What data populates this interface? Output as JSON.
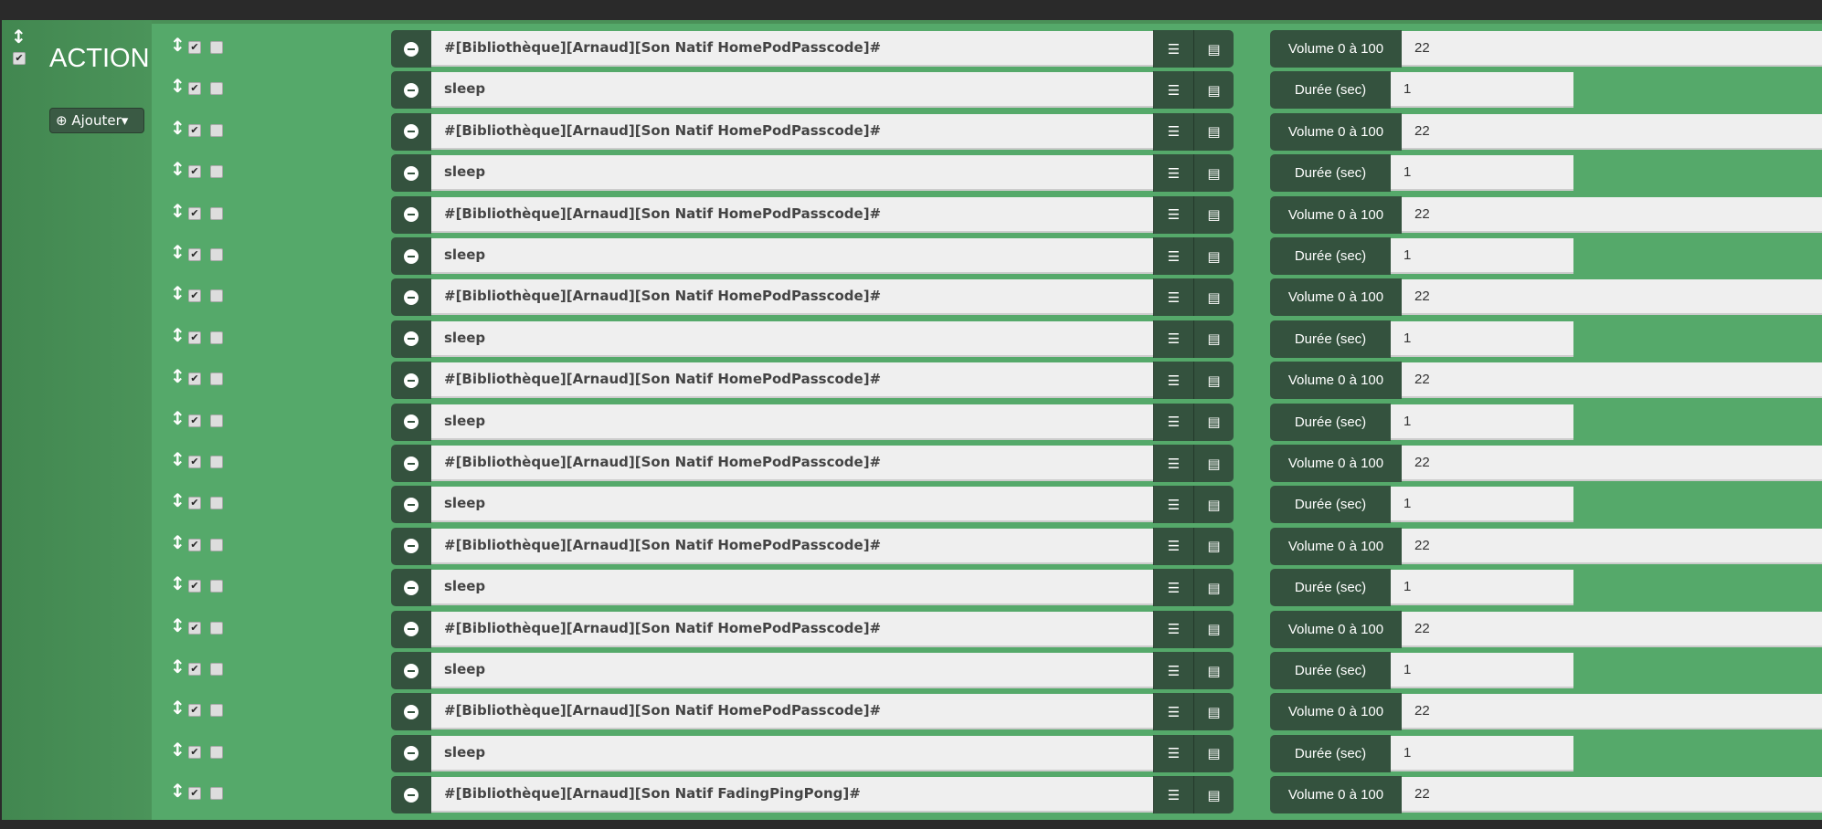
{
  "block": {
    "title": "ACTION",
    "add_label": "Ajouter",
    "enabled": true
  },
  "rows": [
    {
      "expression": "#[Bibliothèque][Arnaud][Son Natif HomePodPasscode]#",
      "param_label": "Volume 0 à 100",
      "param_value": "22"
    },
    {
      "expression": "sleep",
      "param_label": "Durée (sec)",
      "param_value": "1"
    },
    {
      "expression": "#[Bibliothèque][Arnaud][Son Natif HomePodPasscode]#",
      "param_label": "Volume 0 à 100",
      "param_value": "22"
    },
    {
      "expression": "sleep",
      "param_label": "Durée (sec)",
      "param_value": "1"
    },
    {
      "expression": "#[Bibliothèque][Arnaud][Son Natif HomePodPasscode]#",
      "param_label": "Volume 0 à 100",
      "param_value": "22"
    },
    {
      "expression": "sleep",
      "param_label": "Durée (sec)",
      "param_value": "1"
    },
    {
      "expression": "#[Bibliothèque][Arnaud][Son Natif HomePodPasscode]#",
      "param_label": "Volume 0 à 100",
      "param_value": "22"
    },
    {
      "expression": "sleep",
      "param_label": "Durée (sec)",
      "param_value": "1"
    },
    {
      "expression": "#[Bibliothèque][Arnaud][Son Natif HomePodPasscode]#",
      "param_label": "Volume 0 à 100",
      "param_value": "22"
    },
    {
      "expression": "sleep",
      "param_label": "Durée (sec)",
      "param_value": "1"
    },
    {
      "expression": "#[Bibliothèque][Arnaud][Son Natif HomePodPasscode]#",
      "param_label": "Volume 0 à 100",
      "param_value": "22"
    },
    {
      "expression": "sleep",
      "param_label": "Durée (sec)",
      "param_value": "1"
    },
    {
      "expression": "#[Bibliothèque][Arnaud][Son Natif HomePodPasscode]#",
      "param_label": "Volume 0 à 100",
      "param_value": "22"
    },
    {
      "expression": "sleep",
      "param_label": "Durée (sec)",
      "param_value": "1"
    },
    {
      "expression": "#[Bibliothèque][Arnaud][Son Natif HomePodPasscode]#",
      "param_label": "Volume 0 à 100",
      "param_value": "22"
    },
    {
      "expression": "sleep",
      "param_label": "Durée (sec)",
      "param_value": "1"
    },
    {
      "expression": "#[Bibliothèque][Arnaud][Son Natif HomePodPasscode]#",
      "param_label": "Volume 0 à 100",
      "param_value": "22"
    },
    {
      "expression": "sleep",
      "param_label": "Durée (sec)",
      "param_value": "1"
    },
    {
      "expression": "#[Bibliothèque][Arnaud][Son Natif FadingPingPong]#",
      "param_label": "Volume 0 à 100",
      "param_value": "22"
    }
  ]
}
